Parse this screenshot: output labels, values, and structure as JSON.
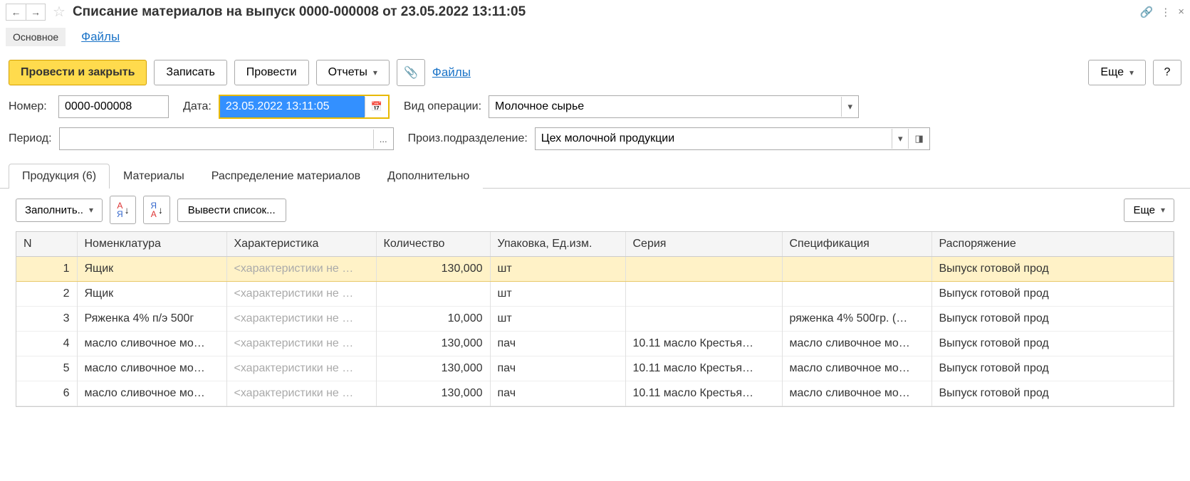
{
  "title": "Списание материалов на выпуск 0000-000008 от 23.05.2022 13:11:05",
  "subnav": {
    "main": "Основное",
    "files": "Файлы"
  },
  "toolbar": {
    "post_close": "Провести и закрыть",
    "save": "Записать",
    "post": "Провести",
    "reports": "Отчеты",
    "files_link": "Файлы",
    "more": "Еще",
    "help": "?"
  },
  "form": {
    "number_label": "Номер:",
    "number_value": "0000-000008",
    "date_label": "Дата:",
    "date_value": "23.05.2022 13:11:05",
    "op_type_label": "Вид операции:",
    "op_type_value": "Молочное сырье",
    "period_label": "Период:",
    "period_value": "",
    "period_btn": "...",
    "dept_label": "Произ.подразделение:",
    "dept_value": "Цех молочной продукции"
  },
  "tabs": {
    "products": "Продукция (6)",
    "materials": "Материалы",
    "distribution": "Распределение материалов",
    "extra": "Дополнительно"
  },
  "table_toolbar": {
    "fill": "Заполнить..",
    "export_list": "Вывести список...",
    "more": "Еще"
  },
  "table": {
    "headers": {
      "n": "N",
      "nom": "Номенклатура",
      "char": "Характеристика",
      "qty": "Количество",
      "unit": "Упаковка, Ед.изм.",
      "series": "Серия",
      "spec": "Спецификация",
      "order": "Распоряжение"
    },
    "char_placeholder": "<характеристики не …",
    "rows": [
      {
        "n": "1",
        "nom": "Ящик",
        "qty": "130,000",
        "unit": "шт",
        "series": "",
        "spec": "",
        "order": "Выпуск готовой прод"
      },
      {
        "n": "2",
        "nom": "Ящик",
        "qty": "",
        "unit": "шт",
        "series": "",
        "spec": "",
        "order": "Выпуск готовой прод"
      },
      {
        "n": "3",
        "nom": "Ряженка 4% п/э 500г",
        "qty": "10,000",
        "unit": "шт",
        "series": "",
        "spec": "ряженка 4% 500гр. (…",
        "order": "Выпуск готовой прод"
      },
      {
        "n": "4",
        "nom": "масло сливочное мо…",
        "qty": "130,000",
        "unit": "пач",
        "series": "10.11 масло Крестья…",
        "spec": "масло сливочное мо…",
        "order": "Выпуск готовой прод"
      },
      {
        "n": "5",
        "nom": "масло сливочное мо…",
        "qty": "130,000",
        "unit": "пач",
        "series": "10.11 масло Крестья…",
        "spec": "масло сливочное мо…",
        "order": "Выпуск готовой прод"
      },
      {
        "n": "6",
        "nom": "масло сливочное мо…",
        "qty": "130,000",
        "unit": "пач",
        "series": "10.11 масло Крестья…",
        "spec": "масло сливочное мо…",
        "order": "Выпуск готовой прод"
      }
    ]
  }
}
